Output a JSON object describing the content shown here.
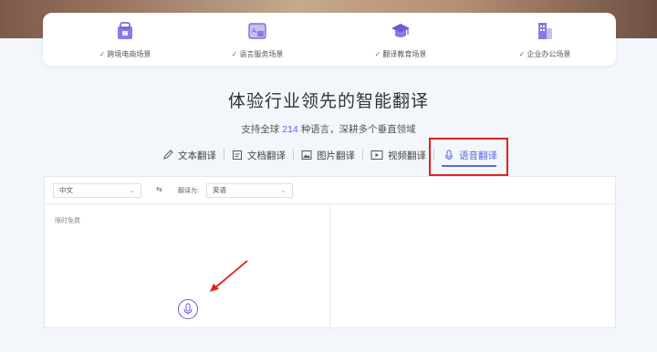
{
  "scenarios": [
    {
      "icon": "cross-border-shop-icon",
      "label": "跨境电商场景"
    },
    {
      "icon": "translation-service-icon",
      "label": "语言服务场景"
    },
    {
      "icon": "education-cap-icon",
      "label": "翻译教育场景"
    },
    {
      "icon": "office-building-icon",
      "label": "企业办公场景"
    }
  ],
  "headline": {
    "title": "体验行业领先的智能翻译",
    "subtitle_prefix": "支持全球",
    "subtitle_number": "214",
    "subtitle_suffix": "种语言，深耕多个垂直领域"
  },
  "tabs": [
    {
      "label": "文本翻译",
      "icon": "pen-icon",
      "active": false
    },
    {
      "label": "文档翻译",
      "icon": "document-icon",
      "active": false
    },
    {
      "label": "图片翻译",
      "icon": "image-icon",
      "active": false
    },
    {
      "label": "视频翻译",
      "icon": "video-icon",
      "active": false
    },
    {
      "label": "语音翻译",
      "icon": "microphone-icon",
      "active": true
    }
  ],
  "translator": {
    "source_language": "中文",
    "swap_symbol": "⇆",
    "target_label": "翻译为:",
    "target_language": "英语",
    "input_placeholder": "限时免费"
  },
  "colors": {
    "accent": "#5b6ad8",
    "highlight_box": "#e0221e"
  }
}
